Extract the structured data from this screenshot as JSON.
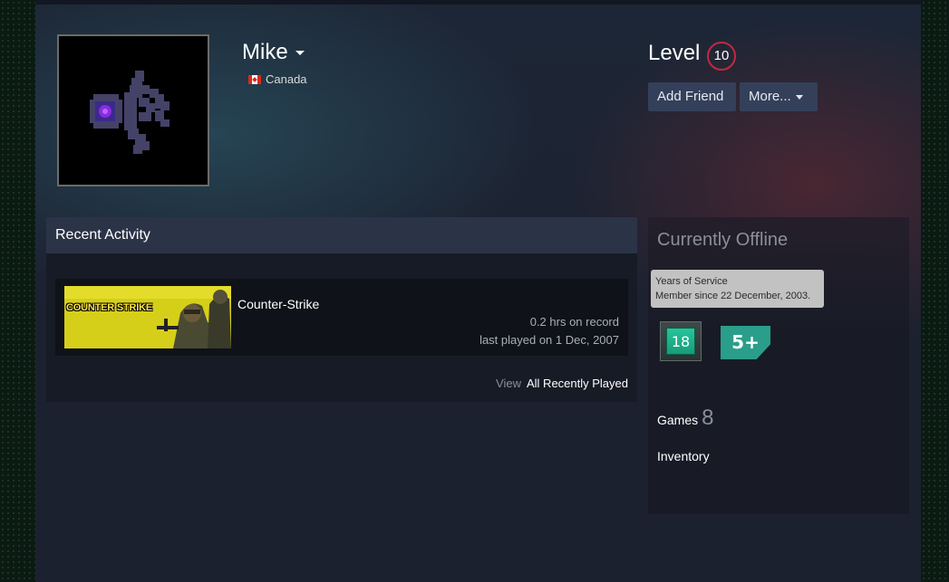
{
  "profile": {
    "name": "Mike",
    "country": "Canada",
    "level_label": "Level",
    "level": "10"
  },
  "actions": {
    "add_friend": "Add Friend",
    "more": "More..."
  },
  "recent_activity": {
    "title": "Recent Activity",
    "games": [
      {
        "capsule_text": "COUNTER STRIKE",
        "name": "Counter-Strike",
        "hours": "0.2 hrs on record",
        "last_played": "last played on 1 Dec, 2007"
      }
    ],
    "view_label": "View",
    "view_link": "All Recently Played"
  },
  "sidebar": {
    "status": "Currently Offline",
    "tooltip": {
      "title": "Years of Service",
      "text": "Member since 22 December, 2003."
    },
    "badges": [
      {
        "label": "18",
        "icon": "years-of-service-badge"
      },
      {
        "label": "5+",
        "icon": "game-collector-badge"
      }
    ],
    "games_label": "Games",
    "games_count": "8",
    "inventory_label": "Inventory"
  },
  "colors": {
    "level_ring": "#c02942",
    "button_bg": "#34405a",
    "header_bg": "#2b3347",
    "badge_teal": "#2a9e8a"
  }
}
